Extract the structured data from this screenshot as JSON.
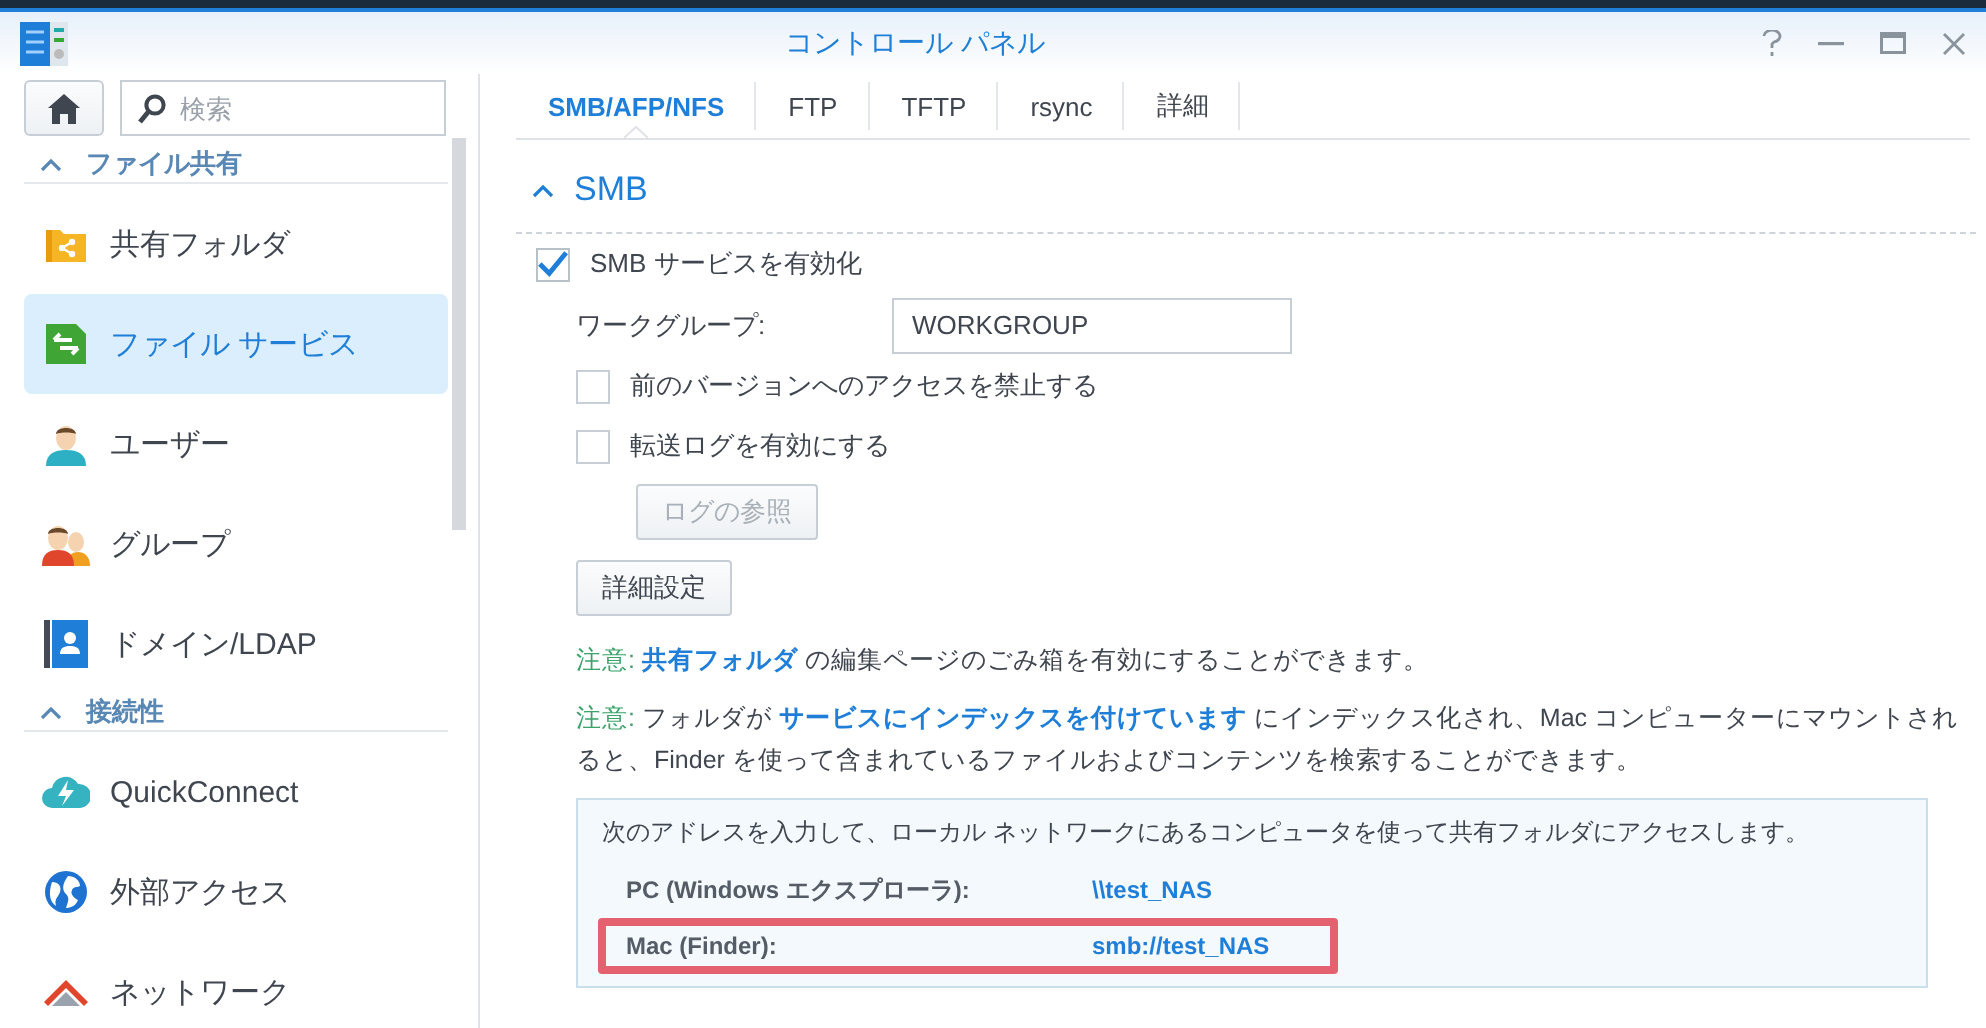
{
  "window": {
    "title": "コントロール パネル"
  },
  "sidebar": {
    "search": {
      "placeholder": "検索"
    },
    "sections": [
      {
        "title": "ファイル共有",
        "expanded": true,
        "items": [
          {
            "kind": "shared-folder",
            "label": "共有フォルダ",
            "selected": false
          },
          {
            "kind": "file-services",
            "label": "ファイル サービス",
            "selected": true
          },
          {
            "kind": "user",
            "label": "ユーザー",
            "selected": false
          },
          {
            "kind": "group",
            "label": "グループ",
            "selected": false
          },
          {
            "kind": "domain",
            "label": "ドメイン/LDAP",
            "selected": false
          }
        ]
      },
      {
        "title": "接続性",
        "expanded": true,
        "items": [
          {
            "kind": "quickconnect",
            "label": "QuickConnect",
            "selected": false
          },
          {
            "kind": "external",
            "label": "外部アクセス",
            "selected": false
          },
          {
            "kind": "network",
            "label": "ネットワーク",
            "selected": false
          }
        ]
      }
    ]
  },
  "tabs": [
    {
      "label": "SMB/AFP/NFS",
      "selected": true
    },
    {
      "label": "FTP",
      "selected": false
    },
    {
      "label": "TFTP",
      "selected": false
    },
    {
      "label": "rsync",
      "selected": false
    },
    {
      "label": "詳細",
      "selected": false
    }
  ],
  "smb": {
    "title": "SMB",
    "expanded": true,
    "enable": {
      "label": "SMB サービスを有効化",
      "checked": true
    },
    "workgroup": {
      "label": "ワークグループ:",
      "value": "WORKGROUP"
    },
    "options": [
      {
        "label": "前のバージョンへのアクセスを禁止する",
        "checked": false
      },
      {
        "label": "転送ログを有効にする",
        "checked": false
      }
    ],
    "log_button": {
      "label": "ログの参照",
      "disabled": true
    },
    "advanced_button": {
      "label": "詳細設定"
    },
    "notes": [
      [
        {
          "kind": "label",
          "text": "注意:"
        },
        {
          "kind": "link",
          "text": "共有フォルダ"
        },
        {
          "kind": "text",
          "text": "の編集ページのごみ箱を有効にすることができます。"
        }
      ],
      [
        {
          "kind": "label",
          "text": "注意:"
        },
        {
          "kind": "text",
          "text": "フォルダが"
        },
        {
          "kind": "link",
          "text": "サービスにインデックスを付けています"
        },
        {
          "kind": "text",
          "text": "にインデックス化され、Mac コンピューターにマウントされると、Finder を使って含まれているファイルおよびコンテンツを検索することができます。"
        }
      ]
    ],
    "address_box": {
      "intro": "次のアドレスを入力して、ローカル ネットワークにあるコンピュータを使って共有フォルダにアクセスします。",
      "rows": [
        {
          "label": "PC (Windows エクスプローラ):",
          "value": "\\\\test_NAS",
          "highlighted": false
        },
        {
          "label": "Mac (Finder):",
          "value": "smb://test_NAS",
          "highlighted": true
        }
      ]
    }
  }
}
